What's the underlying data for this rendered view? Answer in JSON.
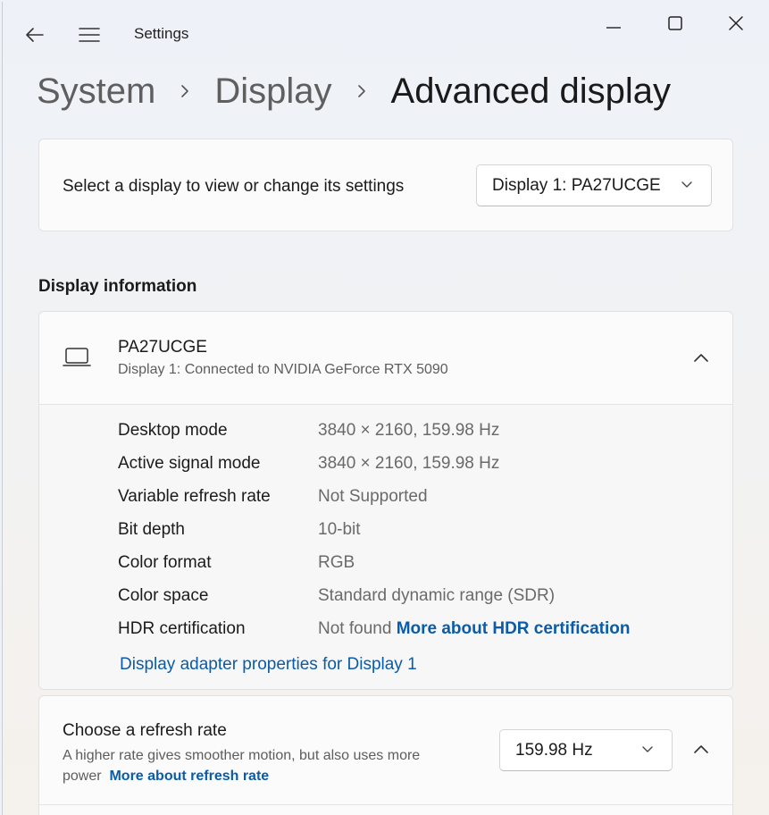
{
  "window": {
    "app_title": "Settings"
  },
  "breadcrumb": {
    "items": [
      "System",
      "Display",
      "Advanced display"
    ]
  },
  "display_select": {
    "label": "Select a display to view or change its settings",
    "selected": "Display 1: PA27UCGE"
  },
  "display_info": {
    "section_title": "Display information",
    "monitor_name": "PA27UCGE",
    "monitor_subtitle": "Display 1: Connected to NVIDIA GeForce RTX 5090",
    "rows": [
      {
        "key": "Desktop mode",
        "value": "3840 × 2160, 159.98 Hz"
      },
      {
        "key": "Active signal mode",
        "value": "3840 × 2160, 159.98 Hz"
      },
      {
        "key": "Variable refresh rate",
        "value": "Not Supported"
      },
      {
        "key": "Bit depth",
        "value": "10-bit"
      },
      {
        "key": "Color format",
        "value": "RGB"
      },
      {
        "key": "Color space",
        "value": "Standard dynamic range (SDR)"
      },
      {
        "key": "HDR certification",
        "value": "Not found",
        "link": "More about HDR certification"
      }
    ],
    "adapter_link": "Display adapter properties for Display 1"
  },
  "refresh_rate": {
    "title": "Choose a refresh rate",
    "description": "A higher rate gives smoother motion, but also uses more power",
    "link": "More about refresh rate",
    "selected": "159.98 Hz"
  },
  "colors": {
    "link": "#0a5ca8",
    "card_background": "#fbfbfb",
    "window_background": "#eef2f8"
  }
}
